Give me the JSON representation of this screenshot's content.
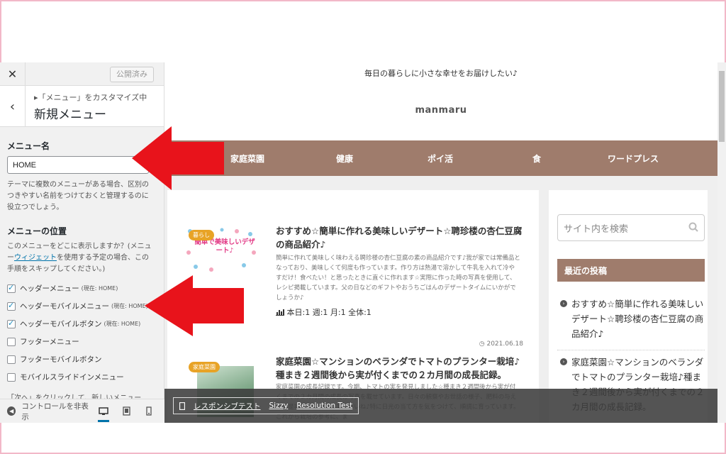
{
  "panel": {
    "publish_label": "公開済み",
    "crumb": "▸「メニュー」をカスタマイズ中",
    "title": "新規メニュー",
    "menu_name_label": "メニュー名",
    "menu_name_value": "HOME",
    "menu_name_desc": "テーマに複数のメニューがある場合、区別のつきやすい名前をつけておくと管理するのに役立つでしょう。",
    "location_label": "メニューの位置",
    "location_desc_1": "このメニューをどこに表示しますか？(メニュー",
    "location_desc_link": "ウィジェット",
    "location_desc_2": "を使用する予定の場合、この手順をスキップしてください。)",
    "locations": [
      {
        "label": "ヘッダーメニュー",
        "note": "(現在: HOME)",
        "checked": true
      },
      {
        "label": "ヘッダーモバイルメニュー",
        "note": "(現在: HOME)",
        "checked": true
      },
      {
        "label": "ヘッダーモバイルボタン",
        "note": "(現在: HOME)",
        "checked": true
      },
      {
        "label": "フッターメニュー",
        "note": "",
        "checked": false
      },
      {
        "label": "フッターモバイルボタン",
        "note": "",
        "checked": false
      },
      {
        "label": "モバイルスライドインメニュー",
        "note": "",
        "checked": false
      }
    ],
    "next_hint": "「次へ」をクリックして、新しいメニュー",
    "hide_controls": "コントロールを非表示"
  },
  "site": {
    "tagline": "毎日の暮らしに小さな幸せをお届けしたい♪",
    "brand": "manmaru",
    "nav": [
      "家庭菜園",
      "健康",
      "ポイ活",
      "食",
      "ワードプレス"
    ],
    "posts": [
      {
        "category": "暮らし",
        "thumb_text": "簡単で美味しいデザート♪",
        "title": "おすすめ☆簡単に作れる美味しいデザート☆聘珍楼の杏仁豆腐の商品紹介♪",
        "excerpt": "簡単に作れて美味しく味わえる聘珍楼の杏仁豆腐の素の商品紹介です♪我が家では常備品となっており、美味しくて何度も作っています。作り方は熱湯で溶かして牛乳を入れて冷やすだけ！食べたい！と思ったときに直ぐに作れます☆実際に作った時の写真を使用して、レシピ掲載しています。父の日などのギフトやおうちごはんのデザートタイムにいかがでしょうか♪",
        "stats": "本日:1 週:1 月:1 全体:1"
      },
      {
        "category": "家庭菜園",
        "date": "2021.06.18",
        "title": "家庭菜園☆マンションのベランダでトマトのプランター栽培♪種まき２週間後から実が付くまでの２カ月間の成長記録。",
        "excerpt": "家庭菜園の成長記録です。今期、トマトの実を発見しました☆種まき２週間後から実が付くまでの２カ月間の成長の写真を載せています。日々の観察やお世話の様子、肥料の与え方は是非参考にしてみて下さいね♪特に日光の当て方を気をつけて、順調に育っています。これから栽培の参考に、ま"
      }
    ],
    "search_placeholder": "サイト内を検索",
    "recent_title": "最近の投稿",
    "recent": [
      "おすすめ☆簡単に作れる美味しいデザート☆聘珍楼の杏仁豆腐の商品紹介♪",
      "家庭菜園☆マンションのベランダでトマトのプランター栽培♪種まき２週間後から実が付くまでの２カ月間の成長記録。"
    ]
  },
  "sizzy": {
    "responsive_test": "レスポンシブテスト",
    "sizzy": "Sizzy",
    "resolution_test": "Resolution Test"
  },
  "colors": {
    "nav_bg": "#9f7c6c",
    "arrow": "#e8131b",
    "accent": "#0073aa"
  }
}
